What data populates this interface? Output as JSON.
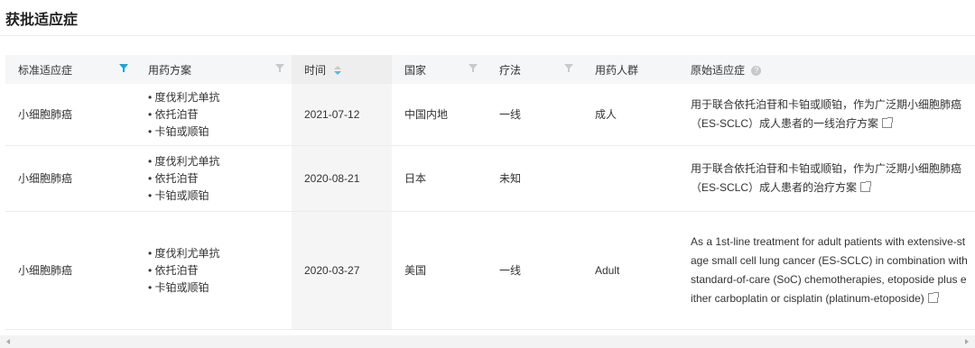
{
  "page": {
    "title": "获批适应症"
  },
  "table": {
    "columns": {
      "standard_indication": "标准适应症",
      "regimen": "用药方案",
      "date": "时间",
      "country": "国家",
      "therapy": "疗法",
      "population": "用药人群",
      "original_indication": "原始适应症"
    },
    "help_glyph": "?",
    "rows": [
      {
        "standard_indication": "小细胞肺癌",
        "regimen": [
          "度伐利尤单抗",
          "依托泊苷",
          "卡铂或顺铂"
        ],
        "date": "2021-07-12",
        "country": "中国内地",
        "therapy": "一线",
        "population": "成人",
        "original_indication": "用于联合依托泊苷和卡铂或顺铂，作为广泛期小细胞肺癌（ES-SCLC）成人患者的一线治疗方案"
      },
      {
        "standard_indication": "小细胞肺癌",
        "regimen": [
          "度伐利尤单抗",
          "依托泊苷",
          "卡铂或顺铂"
        ],
        "date": "2020-08-21",
        "country": "日本",
        "therapy": "未知",
        "population": "",
        "original_indication": "用于联合依托泊苷和卡铂或顺铂，作为广泛期小细胞肺癌（ES-SCLC）成人患者的治疗方案"
      },
      {
        "standard_indication": "小细胞肺癌",
        "regimen": [
          "度伐利尤单抗",
          "依托泊苷",
          "卡铂或顺铂"
        ],
        "date": "2020-03-27",
        "country": "美国",
        "therapy": "一线",
        "population": "Adult",
        "original_indication": "As a 1st-line treatment for adult patients with extensive-stage small cell lung cancer (ES-SCLC) in combination with standard-of-care (SoC) chemotherapies, etoposide plus either carboplatin or cisplatin (platinum-etoposide)"
      }
    ]
  },
  "colors": {
    "accent": "#1aa3d9",
    "header_bg": "#f5f6f7",
    "shaded_col": "#f5f5f5"
  }
}
